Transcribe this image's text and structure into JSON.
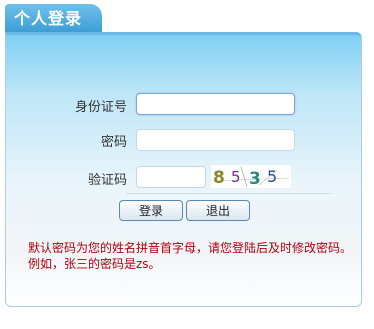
{
  "tab": {
    "title": "个人登录"
  },
  "form": {
    "id_label": "身份证号",
    "id_value": "",
    "password_label": "密码",
    "password_value": "",
    "captcha_label": "验证码",
    "captcha_value": "",
    "captcha_text": "8535"
  },
  "buttons": {
    "login": "登录",
    "exit": "退出"
  },
  "notice": {
    "line1": "默认密码为您的姓名拼音首字母，请您登陆后及时修改密码。",
    "line2": "例如，张三的密码是zs。"
  },
  "colors": {
    "accent": "#3d9fd6",
    "notice": "#b3000c",
    "captcha_digits": [
      "#8a8a2a",
      "#7a2f8f",
      "#2a8a7a",
      "#2a4f8a"
    ]
  }
}
